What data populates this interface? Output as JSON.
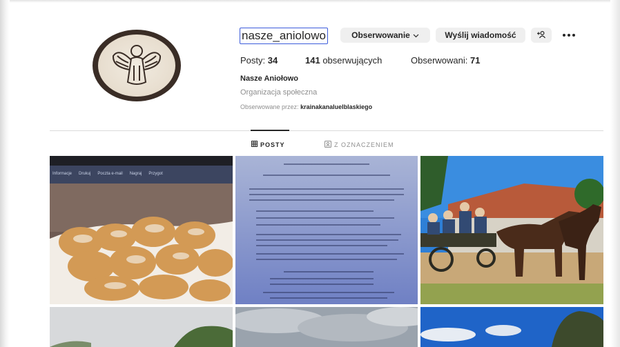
{
  "profile": {
    "username": "nasze_aniolowo",
    "follow_button_label": "Obserwowanie",
    "message_button_label": "Wyślij wiadomość",
    "stats": {
      "posts_label": "Posty:",
      "posts_count": "34",
      "followers_count": "141",
      "followers_label": "obserwujących",
      "following_label": "Obserwowani:",
      "following_count": "71"
    },
    "full_name": "Nasze Aniołowo",
    "category": "Organizacja społeczna",
    "followed_by_label": "Obserwowane przez:",
    "followed_by_user": "krainakanaluelblaskiego"
  },
  "tabs": [
    {
      "label": "POSTY",
      "icon": "grid-icon",
      "active": true
    },
    {
      "label": "Z OZNACZENIEM",
      "icon": "tag-icon",
      "active": false
    }
  ],
  "posts": [
    {
      "type": "photo-screen-pastries",
      "toolbar_items": [
        "Informacje",
        "Drukuj",
        "Poczta e-mail",
        "Nagraj",
        "Przygot"
      ]
    },
    {
      "type": "photo-document-poster"
    },
    {
      "type": "photo-horse-carriage"
    },
    {
      "type": "photo-sky-trees"
    },
    {
      "type": "photo-cloudy-sky"
    },
    {
      "type": "photo-blue-sky-tree"
    }
  ],
  "colors": {
    "text_primary": "#262626",
    "text_secondary": "#8e8e8e",
    "button_bg": "#efefef",
    "divider": "#dbdbdb",
    "focus_outline": "#3b5bdb"
  }
}
